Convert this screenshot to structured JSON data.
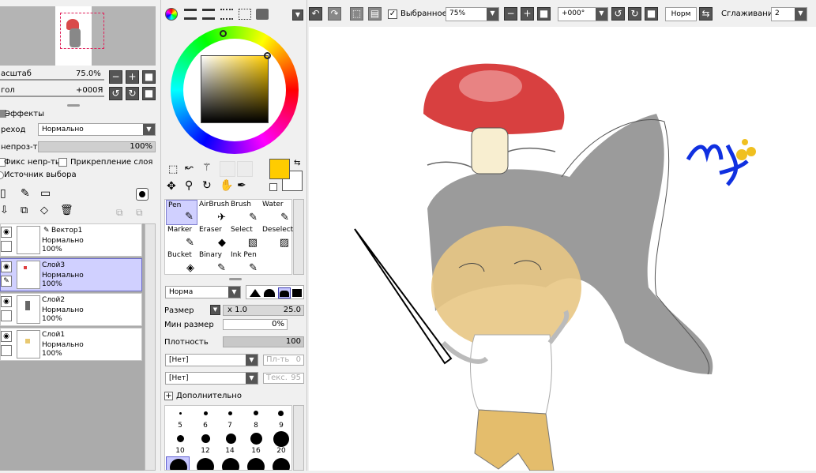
{
  "nav": {
    "scale_label": "асштаб",
    "scale_value": "75.0%",
    "angle_label": "гол",
    "angle_value": "+000Я"
  },
  "effects": {
    "title": "Эффекты",
    "blend_label": "реход",
    "blend_value": "Нормально",
    "opacity_label": "непроз-ть",
    "opacity_value": "100%",
    "fix_opacity": "Фикс непр-ть",
    "clip_layer": "Прикрепление слоя",
    "selection_source": "Источник выбора"
  },
  "layers": [
    {
      "name": "Вектор1",
      "mode": "Нормально",
      "opacity": "100%"
    },
    {
      "name": "Слой3",
      "mode": "Нормально",
      "opacity": "100%"
    },
    {
      "name": "Слой2",
      "mode": "Нормально",
      "opacity": "100%"
    },
    {
      "name": "Слой1",
      "mode": "Нормально",
      "opacity": "100%"
    }
  ],
  "colors": {
    "primary": "#ffcc00"
  },
  "tools": [
    {
      "label": "Pen",
      "icon": "✎"
    },
    {
      "label": "AirBrush",
      "icon": "✈"
    },
    {
      "label": "Brush",
      "icon": "✎"
    },
    {
      "label": "Water",
      "icon": "✎"
    },
    {
      "label": "Marker",
      "icon": "✎"
    },
    {
      "label": "Eraser",
      "icon": "◆"
    },
    {
      "label": "Select",
      "icon": "▧"
    },
    {
      "label": "Deselect",
      "icon": "▨"
    },
    {
      "label": "Bucket",
      "icon": "◈"
    },
    {
      "label": "Binary",
      "icon": "✎"
    },
    {
      "label": "Ink Pen",
      "icon": "✎"
    }
  ],
  "brush": {
    "mode": "Норма",
    "size_label": "Размер",
    "size_mult": "x 1.0",
    "size_value": "25.0",
    "min_size_label": "Мин размер",
    "min_size_value": "0%",
    "density_label": "Плотность",
    "density_value": "100",
    "tex1": "[Нет]",
    "tex2": "[Нет]",
    "tex1_right": "Пл-ть",
    "tex1_right_val": "0",
    "tex2_right": "Текс.",
    "tex2_right_val": "95",
    "advanced": "Дополнительно",
    "sizes": [
      "5",
      "6",
      "7",
      "8",
      "9",
      "10",
      "12",
      "14",
      "16",
      "20"
    ]
  },
  "toolbar": {
    "selected": "Выбранное",
    "zoom": "75%",
    "rotation": "+000°",
    "mode": "Норм",
    "smoothing_label": "Сглаживание",
    "smoothing_value": "2"
  }
}
